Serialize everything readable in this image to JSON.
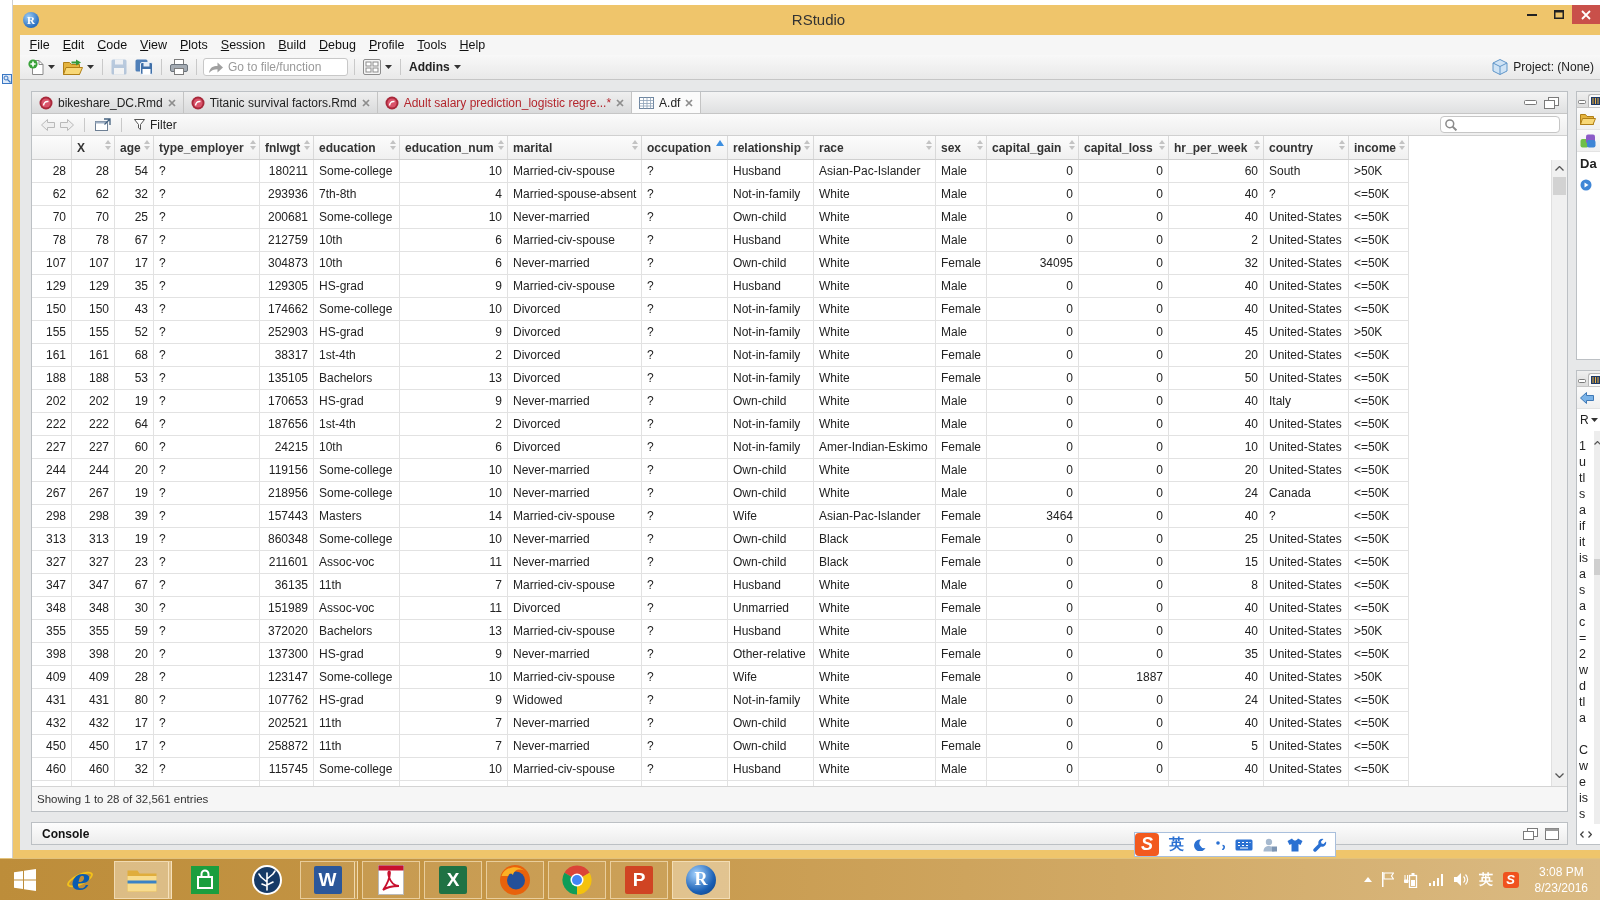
{
  "window": {
    "logo": "R",
    "title": "RStudio"
  },
  "menu": [
    "File",
    "Edit",
    "Code",
    "View",
    "Plots",
    "Session",
    "Build",
    "Debug",
    "Profile",
    "Tools",
    "Help"
  ],
  "toolbar": {
    "groups": [
      [
        {
          "kind": "new",
          "dropdown": true,
          "disabled": false
        },
        {
          "kind": "open",
          "dropdown": true,
          "disabled": false
        }
      ],
      [
        {
          "kind": "save",
          "dropdown": false,
          "disabled": true
        },
        {
          "kind": "saveall",
          "dropdown": false,
          "disabled": false
        }
      ],
      [
        {
          "kind": "print",
          "dropdown": false,
          "disabled": false
        }
      ],
      [
        {
          "kind": "goto",
          "placeholder": "Go to file/function"
        }
      ],
      [
        {
          "kind": "layout",
          "dropdown": true,
          "disabled": false
        }
      ],
      [
        {
          "kind": "addins",
          "label": "Addins",
          "dropdown": true
        }
      ]
    ],
    "project": "Project: (None)"
  },
  "editor_tabs": [
    {
      "kind": "rmd",
      "label": "bikeshare_DC.Rmd",
      "selected": false,
      "modified": false
    },
    {
      "kind": "rmd",
      "label": "Titanic survival factors.Rmd",
      "selected": false,
      "modified": false
    },
    {
      "kind": "rmd",
      "label": "Adult salary prediction_logistic regre...*",
      "selected": false,
      "modified": true
    },
    {
      "kind": "table",
      "label": "A.df",
      "selected": true,
      "modified": false
    }
  ],
  "data_toolbar": {
    "back": {
      "disabled": true
    },
    "forward": {
      "disabled": true
    },
    "filter": "Filter"
  },
  "table": {
    "columns": [
      {
        "label": "X",
        "kind": "number",
        "sorted": false
      },
      {
        "label": "age",
        "kind": "number",
        "sorted": false
      },
      {
        "label": "type_employer",
        "kind": "text",
        "sorted": false
      },
      {
        "label": "fnlwgt",
        "kind": "number",
        "sorted": false
      },
      {
        "label": "education",
        "kind": "text",
        "sorted": false
      },
      {
        "label": "education_num",
        "kind": "number",
        "sorted": false
      },
      {
        "label": "marital",
        "kind": "text",
        "sorted": false
      },
      {
        "label": "occupation",
        "kind": "text",
        "sorted": true
      },
      {
        "label": "relationship",
        "kind": "text",
        "sorted": false
      },
      {
        "label": "race",
        "kind": "text",
        "sorted": false
      },
      {
        "label": "sex",
        "kind": "text",
        "sorted": false
      },
      {
        "label": "capital_gain",
        "kind": "number",
        "sorted": false
      },
      {
        "label": "capital_loss",
        "kind": "number",
        "sorted": false
      },
      {
        "label": "hr_per_week",
        "kind": "number",
        "sorted": false
      },
      {
        "label": "country",
        "kind": "text",
        "sorted": false
      },
      {
        "label": "income",
        "kind": "text",
        "sorted": false
      }
    ],
    "rows": [
      {
        "row_name": "28",
        "cells": [
          "28",
          "54",
          "?",
          "180211",
          "Some-college",
          "10",
          "Married-civ-spouse",
          "?",
          "Husband",
          "Asian-Pac-Islander",
          "Male",
          "0",
          "0",
          "60",
          "South",
          ">50K"
        ]
      },
      {
        "row_name": "62",
        "cells": [
          "62",
          "32",
          "?",
          "293936",
          "7th-8th",
          "4",
          "Married-spouse-absent",
          "?",
          "Not-in-family",
          "White",
          "Male",
          "0",
          "0",
          "40",
          "?",
          "<=50K"
        ]
      },
      {
        "row_name": "70",
        "cells": [
          "70",
          "25",
          "?",
          "200681",
          "Some-college",
          "10",
          "Never-married",
          "?",
          "Own-child",
          "White",
          "Male",
          "0",
          "0",
          "40",
          "United-States",
          "<=50K"
        ]
      },
      {
        "row_name": "78",
        "cells": [
          "78",
          "67",
          "?",
          "212759",
          "10th",
          "6",
          "Married-civ-spouse",
          "?",
          "Husband",
          "White",
          "Male",
          "0",
          "0",
          "2",
          "United-States",
          "<=50K"
        ]
      },
      {
        "row_name": "107",
        "cells": [
          "107",
          "17",
          "?",
          "304873",
          "10th",
          "6",
          "Never-married",
          "?",
          "Own-child",
          "White",
          "Female",
          "34095",
          "0",
          "32",
          "United-States",
          "<=50K"
        ]
      },
      {
        "row_name": "129",
        "cells": [
          "129",
          "35",
          "?",
          "129305",
          "HS-grad",
          "9",
          "Married-civ-spouse",
          "?",
          "Husband",
          "White",
          "Male",
          "0",
          "0",
          "40",
          "United-States",
          "<=50K"
        ]
      },
      {
        "row_name": "150",
        "cells": [
          "150",
          "43",
          "?",
          "174662",
          "Some-college",
          "10",
          "Divorced",
          "?",
          "Not-in-family",
          "White",
          "Female",
          "0",
          "0",
          "40",
          "United-States",
          "<=50K"
        ]
      },
      {
        "row_name": "155",
        "cells": [
          "155",
          "52",
          "?",
          "252903",
          "HS-grad",
          "9",
          "Divorced",
          "?",
          "Not-in-family",
          "White",
          "Male",
          "0",
          "0",
          "45",
          "United-States",
          ">50K"
        ]
      },
      {
        "row_name": "161",
        "cells": [
          "161",
          "68",
          "?",
          "38317",
          "1st-4th",
          "2",
          "Divorced",
          "?",
          "Not-in-family",
          "White",
          "Female",
          "0",
          "0",
          "20",
          "United-States",
          "<=50K"
        ]
      },
      {
        "row_name": "188",
        "cells": [
          "188",
          "53",
          "?",
          "135105",
          "Bachelors",
          "13",
          "Divorced",
          "?",
          "Not-in-family",
          "White",
          "Female",
          "0",
          "0",
          "50",
          "United-States",
          "<=50K"
        ]
      },
      {
        "row_name": "202",
        "cells": [
          "202",
          "19",
          "?",
          "170653",
          "HS-grad",
          "9",
          "Never-married",
          "?",
          "Own-child",
          "White",
          "Male",
          "0",
          "0",
          "40",
          "Italy",
          "<=50K"
        ]
      },
      {
        "row_name": "222",
        "cells": [
          "222",
          "64",
          "?",
          "187656",
          "1st-4th",
          "2",
          "Divorced",
          "?",
          "Not-in-family",
          "White",
          "Male",
          "0",
          "0",
          "40",
          "United-States",
          "<=50K"
        ]
      },
      {
        "row_name": "227",
        "cells": [
          "227",
          "60",
          "?",
          "24215",
          "10th",
          "6",
          "Divorced",
          "?",
          "Not-in-family",
          "Amer-Indian-Eskimo",
          "Female",
          "0",
          "0",
          "10",
          "United-States",
          "<=50K"
        ]
      },
      {
        "row_name": "244",
        "cells": [
          "244",
          "20",
          "?",
          "119156",
          "Some-college",
          "10",
          "Never-married",
          "?",
          "Own-child",
          "White",
          "Male",
          "0",
          "0",
          "20",
          "United-States",
          "<=50K"
        ]
      },
      {
        "row_name": "267",
        "cells": [
          "267",
          "19",
          "?",
          "218956",
          "Some-college",
          "10",
          "Never-married",
          "?",
          "Own-child",
          "White",
          "Male",
          "0",
          "0",
          "24",
          "Canada",
          "<=50K"
        ]
      },
      {
        "row_name": "298",
        "cells": [
          "298",
          "39",
          "?",
          "157443",
          "Masters",
          "14",
          "Married-civ-spouse",
          "?",
          "Wife",
          "Asian-Pac-Islander",
          "Female",
          "3464",
          "0",
          "40",
          "?",
          "<=50K"
        ]
      },
      {
        "row_name": "313",
        "cells": [
          "313",
          "19",
          "?",
          "860348",
          "Some-college",
          "10",
          "Never-married",
          "?",
          "Own-child",
          "Black",
          "Female",
          "0",
          "0",
          "25",
          "United-States",
          "<=50K"
        ]
      },
      {
        "row_name": "327",
        "cells": [
          "327",
          "23",
          "?",
          "211601",
          "Assoc-voc",
          "11",
          "Never-married",
          "?",
          "Own-child",
          "Black",
          "Female",
          "0",
          "0",
          "15",
          "United-States",
          "<=50K"
        ]
      },
      {
        "row_name": "347",
        "cells": [
          "347",
          "67",
          "?",
          "36135",
          "11th",
          "7",
          "Married-civ-spouse",
          "?",
          "Husband",
          "White",
          "Male",
          "0",
          "0",
          "8",
          "United-States",
          "<=50K"
        ]
      },
      {
        "row_name": "348",
        "cells": [
          "348",
          "30",
          "?",
          "151989",
          "Assoc-voc",
          "11",
          "Divorced",
          "?",
          "Unmarried",
          "White",
          "Female",
          "0",
          "0",
          "40",
          "United-States",
          "<=50K"
        ]
      },
      {
        "row_name": "355",
        "cells": [
          "355",
          "59",
          "?",
          "372020",
          "Bachelors",
          "13",
          "Married-civ-spouse",
          "?",
          "Husband",
          "White",
          "Male",
          "0",
          "0",
          "40",
          "United-States",
          ">50K"
        ]
      },
      {
        "row_name": "398",
        "cells": [
          "398",
          "20",
          "?",
          "137300",
          "HS-grad",
          "9",
          "Never-married",
          "?",
          "Other-relative",
          "White",
          "Female",
          "0",
          "0",
          "35",
          "United-States",
          "<=50K"
        ]
      },
      {
        "row_name": "409",
        "cells": [
          "409",
          "28",
          "?",
          "123147",
          "Some-college",
          "10",
          "Married-civ-spouse",
          "?",
          "Wife",
          "White",
          "Female",
          "0",
          "1887",
          "40",
          "United-States",
          ">50K"
        ]
      },
      {
        "row_name": "431",
        "cells": [
          "431",
          "80",
          "?",
          "107762",
          "HS-grad",
          "9",
          "Widowed",
          "?",
          "Not-in-family",
          "White",
          "Male",
          "0",
          "0",
          "24",
          "United-States",
          "<=50K"
        ]
      },
      {
        "row_name": "432",
        "cells": [
          "432",
          "17",
          "?",
          "202521",
          "11th",
          "7",
          "Never-married",
          "?",
          "Own-child",
          "White",
          "Male",
          "0",
          "0",
          "40",
          "United-States",
          "<=50K"
        ]
      },
      {
        "row_name": "450",
        "cells": [
          "450",
          "17",
          "?",
          "258872",
          "11th",
          "7",
          "Never-married",
          "?",
          "Own-child",
          "White",
          "Female",
          "0",
          "0",
          "5",
          "United-States",
          "<=50K"
        ]
      },
      {
        "row_name": "460",
        "cells": [
          "460",
          "32",
          "?",
          "115745",
          "Some-college",
          "10",
          "Married-civ-spouse",
          "?",
          "Husband",
          "White",
          "Male",
          "0",
          "0",
          "40",
          "United-States",
          "<=50K"
        ]
      }
    ]
  },
  "status": "Showing 1 to 28 of 32,561 entries",
  "console": {
    "title": "Console"
  },
  "side_panes": {
    "top": {
      "heading": "Da"
    },
    "bottom": {
      "dropdown": "R",
      "paragraphs": [
        [
          "1",
          "u",
          "tl",
          "s",
          "a",
          "if",
          "it",
          "is",
          "a",
          "s",
          "a",
          "c",
          "=",
          "2",
          "w",
          "d",
          "tl",
          "a"
        ],
        [
          "C",
          "w",
          "e",
          "is",
          "s"
        ]
      ]
    }
  },
  "ime_bar": {
    "logo": "S",
    "mode": "英"
  },
  "taskbar": {
    "apps": [
      {
        "kind": "ie",
        "glyph": "e",
        "running": false,
        "highlighted": false,
        "stacked": false
      },
      {
        "kind": "explorer",
        "running": true,
        "highlighted": true,
        "stacked": true
      },
      {
        "kind": "store",
        "running": false,
        "highlighted": false,
        "stacked": false
      },
      {
        "kind": "tree",
        "running": false,
        "highlighted": false,
        "stacked": false
      },
      {
        "kind": "word",
        "glyph": "W",
        "running": true,
        "highlighted": false,
        "stacked": true
      },
      {
        "kind": "pdf",
        "running": true,
        "highlighted": false,
        "stacked": false
      },
      {
        "kind": "excel",
        "glyph": "X",
        "running": true,
        "highlighted": false,
        "stacked": false
      },
      {
        "kind": "firefox",
        "running": true,
        "highlighted": false,
        "stacked": false
      },
      {
        "kind": "chrome",
        "running": true,
        "highlighted": false,
        "stacked": false
      },
      {
        "kind": "slides",
        "glyph": "P",
        "running": true,
        "highlighted": false,
        "stacked": false
      },
      {
        "kind": "r",
        "glyph": "R",
        "running": true,
        "highlighted": true,
        "stacked": false
      }
    ],
    "tray": {
      "language": "英",
      "logo": "S",
      "time": "3:08 PM",
      "date": "8/23/2016"
    }
  }
}
